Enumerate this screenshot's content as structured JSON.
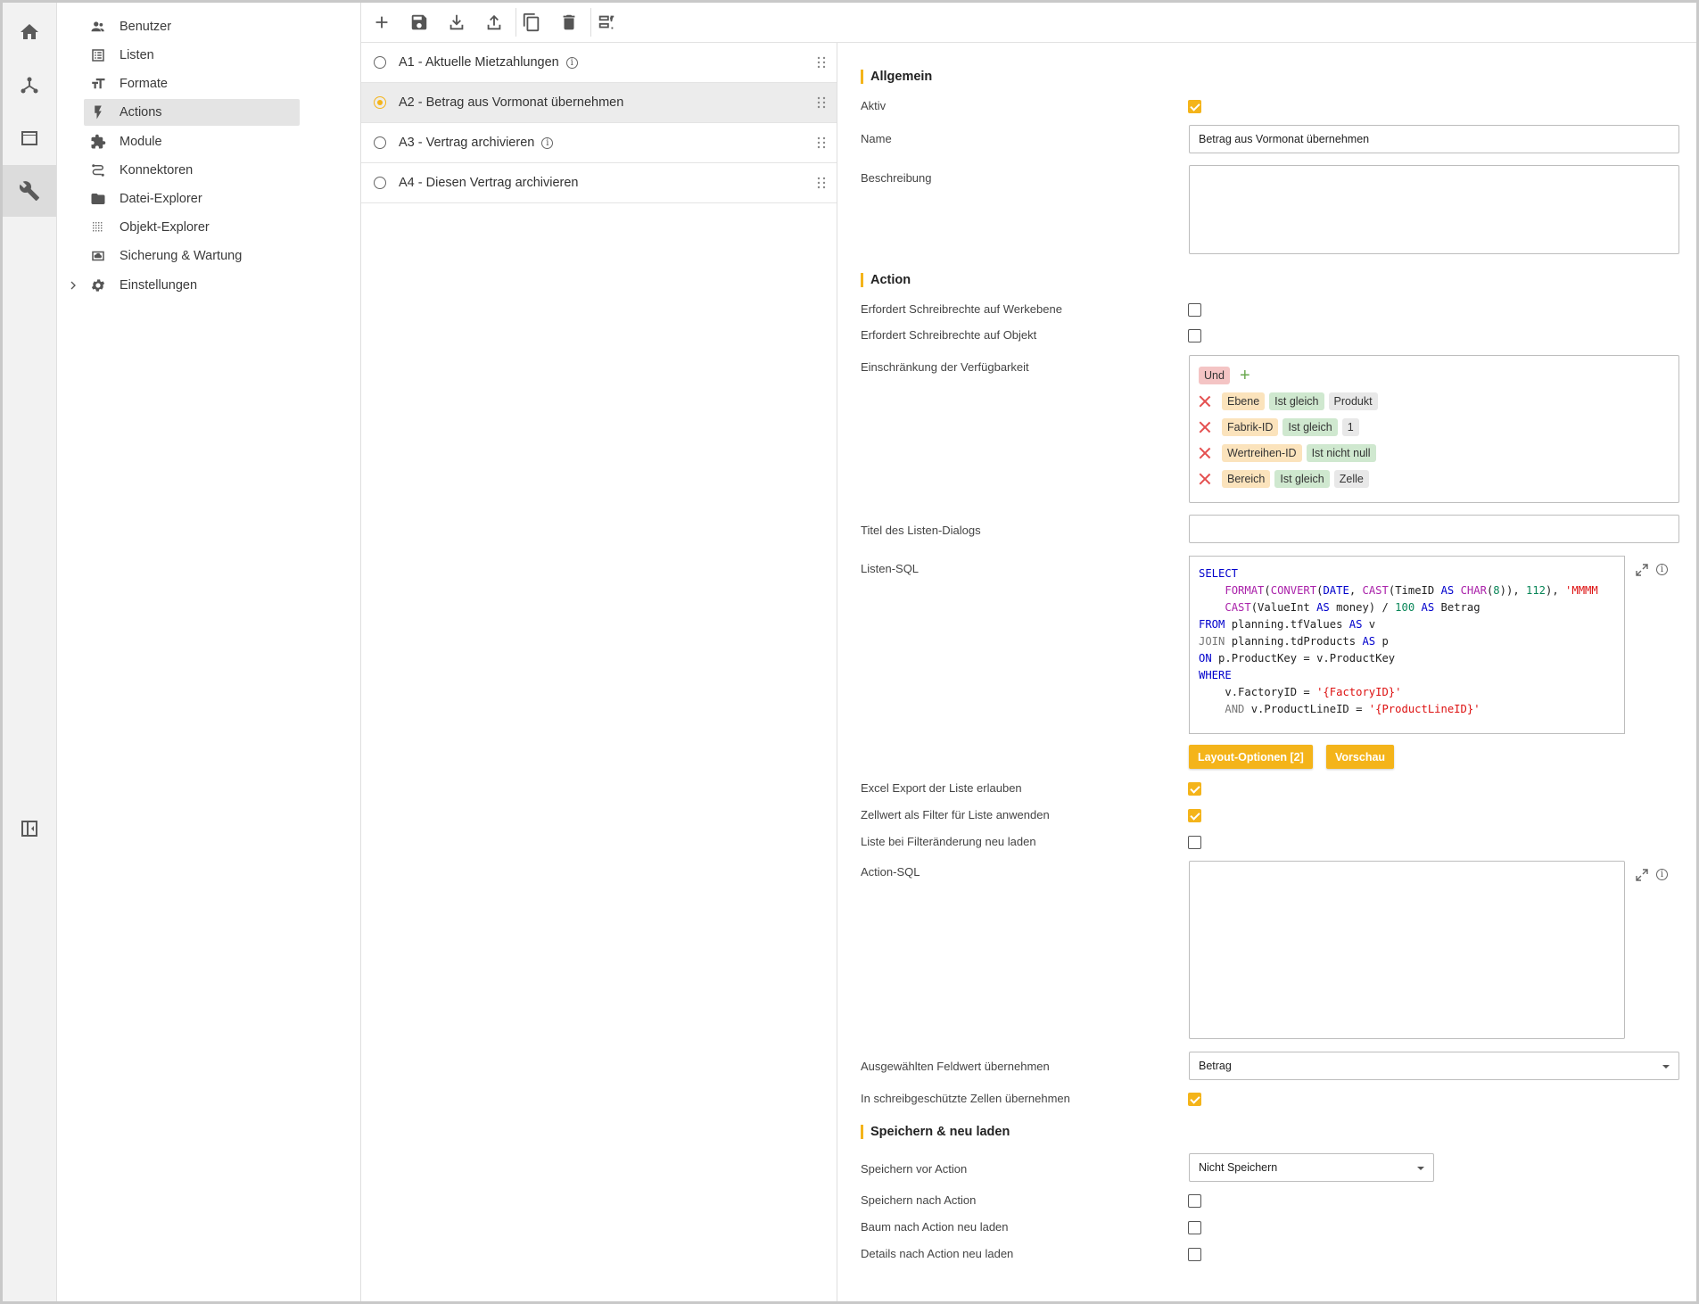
{
  "nav": {
    "items": [
      {
        "label": "Benutzer",
        "icon": "users-icon"
      },
      {
        "label": "Listen",
        "icon": "list-icon"
      },
      {
        "label": "Formate",
        "icon": "text-format-icon"
      },
      {
        "label": "Actions",
        "icon": "lightning-icon"
      },
      {
        "label": "Module",
        "icon": "puzzle-icon"
      },
      {
        "label": "Konnektoren",
        "icon": "connector-icon"
      },
      {
        "label": "Datei-Explorer",
        "icon": "folder-icon"
      },
      {
        "label": "Objekt-Explorer",
        "icon": "grid-dots-icon"
      },
      {
        "label": "Sicherung & Wartung",
        "icon": "cloud-backup-icon"
      },
      {
        "label": "Einstellungen",
        "icon": "gear-icon"
      }
    ],
    "active": "Actions"
  },
  "actions_list": [
    {
      "label": "A1 - Aktuelle Mietzahlungen",
      "info": true
    },
    {
      "label": "A2 - Betrag aus Vormonat übernehmen",
      "info": false,
      "selected": true
    },
    {
      "label": "A3 - Vertrag archivieren",
      "info": true
    },
    {
      "label": "A4 - Diesen Vertrag archivieren",
      "info": false
    }
  ],
  "detail": {
    "sec_general": "Allgemein",
    "aktiv_label": "Aktiv",
    "name_label": "Name",
    "name_value": "Betrag aus Vormonat übernehmen",
    "beschreibung_label": "Beschreibung",
    "sec_action": "Action",
    "schreib_werk": "Erfordert Schreibrechte auf Werkebene",
    "schreib_obj": "Erfordert Schreibrechte auf Objekt",
    "einschr_label": "Einschränkung der Verfügbarkeit",
    "und": "Und",
    "conditions": [
      {
        "field": "Ebene",
        "op": "Ist gleich",
        "value": "Produkt"
      },
      {
        "field": "Fabrik-ID",
        "op": "Ist gleich",
        "value": "1"
      },
      {
        "field": "Wertreihen-ID",
        "op": "Ist nicht null",
        "value": ""
      },
      {
        "field": "Bereich",
        "op": "Ist gleich",
        "value": "Zelle"
      }
    ],
    "titel_label": "Titel des Listen-Dialogs",
    "listen_sql_label": "Listen-SQL",
    "sql": {
      "l1": "SELECT",
      "l2a": "FORMAT",
      "l2b": "(",
      "l2c": "CONVERT",
      "l2d": "(",
      "l2e": "DATE",
      ", ": ", ",
      "l2f": "CAST",
      "l2g": "(TimeID ",
      "l2h": "AS",
      "l2i": " ",
      "l2j": "CHAR",
      "l2k": "(",
      "l2l": "8",
      "l2m": ")), ",
      "l2n": "112",
      "l2o": "), ",
      "l2p": "'MMMM",
      "l3a": "CAST",
      "l3b": "(ValueInt ",
      "l3c": "AS",
      "l3d": " money) / ",
      "l3e": "100",
      "l3f": " ",
      "l3g": "AS",
      "l3h": " Betrag",
      "l4a": "FROM",
      "l4b": " planning.tfValues ",
      "l4c": "AS",
      "l4d": " v",
      "l5a": "JOIN",
      "l5b": " planning.tdProducts ",
      "l5c": "AS",
      "l5d": " p",
      "l6a": "ON",
      "l6b": " p.ProductKey = v.ProductKey",
      "l7": "WHERE",
      "l8a": "v.FactoryID = ",
      "l8b": "'{FactoryID}'",
      "l9a": "AND",
      "l9b": " v.ProductLineID = ",
      "l9c": "'{ProductLineID}'"
    },
    "layout_btn": "Layout-Optionen [2]",
    "vorschau_btn": "Vorschau",
    "excel_label": "Excel Export der Liste erlauben",
    "zellwert_label": "Zellwert als Filter für Liste anwenden",
    "filter_reload_label": "Liste bei Filteränderung neu laden",
    "action_sql_label": "Action-SQL",
    "feldwert_label": "Ausgewählten Feldwert übernehmen",
    "feldwert_value": "Betrag",
    "schreibgeschuetzt_label": "In schreibgeschützte Zellen übernehmen",
    "sec_save": "Speichern & neu laden",
    "speichern_vor_label": "Speichern vor Action",
    "speichern_vor_value": "Nicht Speichern",
    "speichern_nach_label": "Speichern nach Action",
    "baum_label": "Baum nach Action neu laden",
    "details_label": "Details nach Action neu laden"
  },
  "colors": {
    "accent": "#f4b41a",
    "danger": "#e45050"
  }
}
